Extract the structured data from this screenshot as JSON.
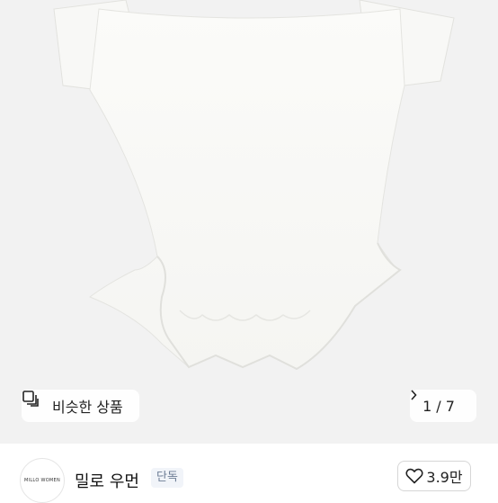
{
  "image": {
    "similar_label": "비슷한 상품",
    "similar_icon": "similar-items-icon",
    "pager": {
      "current": "1",
      "separator": "/",
      "total": "7"
    }
  },
  "seller": {
    "logo_text": "MILLO WOMEN",
    "name": "밀로 우먼",
    "badge": "단독"
  },
  "like": {
    "count": "3.9만",
    "icon": "heart-outline-icon"
  },
  "colors": {
    "image_bg": "#f2f2f2",
    "badge_bg": "#f1f4f9",
    "badge_text": "#6d7d95"
  }
}
